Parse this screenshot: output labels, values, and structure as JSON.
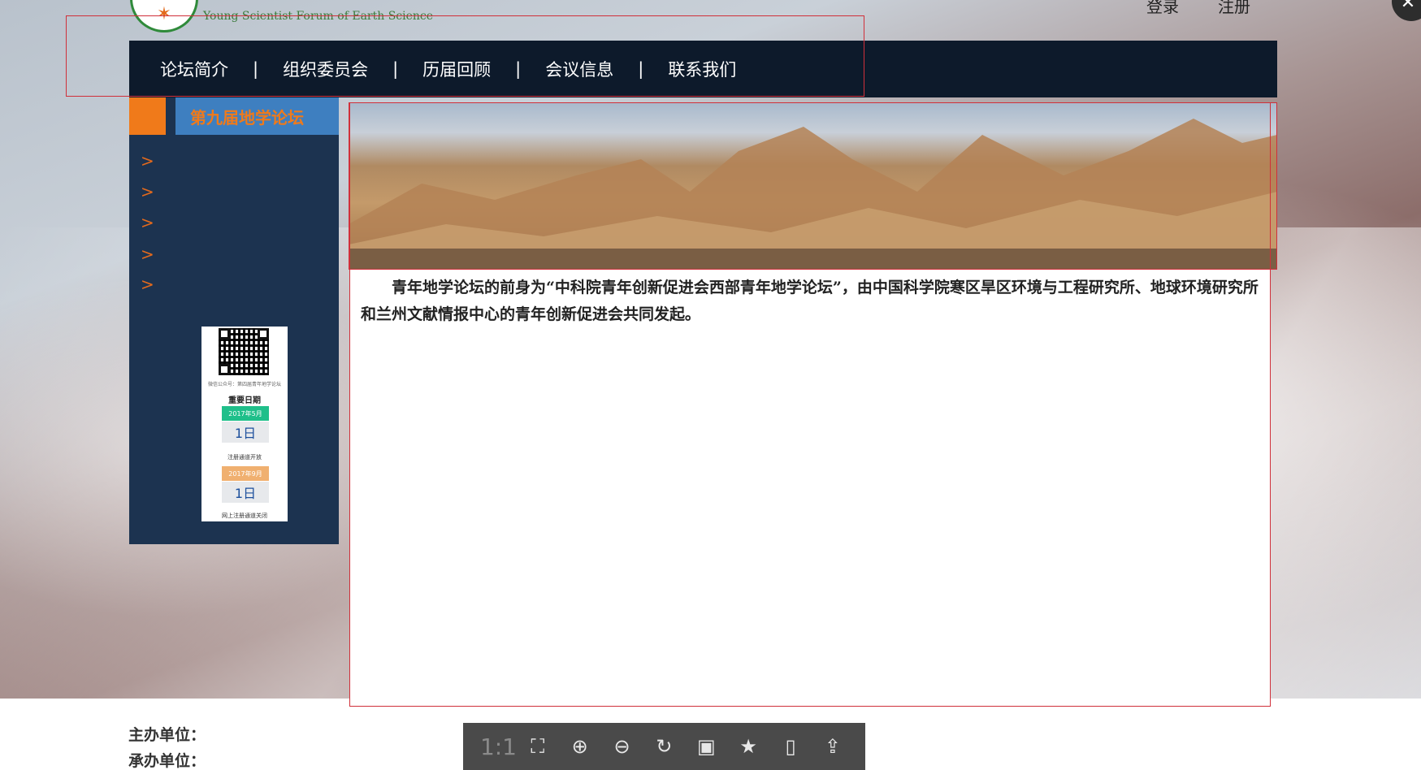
{
  "header": {
    "subtitle": "Young Scientist Forum of Earth Science",
    "login_label": "登录",
    "register_label": "注册",
    "close_icon": "close-icon"
  },
  "nav": {
    "items": [
      "论坛简介",
      "组织委员会",
      "历届回顾",
      "会议信息",
      "联系我们"
    ],
    "separator": "|"
  },
  "sidebar": {
    "title": "第九届地学论坛",
    "arrow_glyph": ">",
    "qr_caption": "微信公众号：第四届青年地学论坛",
    "dates_title": "重要日期",
    "dates": [
      {
        "month": "2017年5月",
        "day": "1日",
        "note": "注册通道开放",
        "color": "#1fbf8a"
      },
      {
        "month": "2017年9月",
        "day": "1日",
        "note": "网上注册通道关闭",
        "color": "#f0b070"
      }
    ]
  },
  "content": {
    "intro": "青年地学论坛的前身为“中科院青年创新促进会西部青年地学论坛”，由中国科学院寒区旱区环境与工程研究所、地球环境研究所和兰州文献情报中心的青年创新促进会共同发起。"
  },
  "footer": {
    "host_label": "主办单位：",
    "organizer_label": "承办单位："
  },
  "viewer_toolbar": {
    "actual_size_label": "1:1",
    "icons": [
      "fit-screen-icon",
      "zoom-in-icon",
      "zoom-out-icon",
      "rotate-icon",
      "save-icon",
      "bookmark-icon",
      "tablet-icon",
      "share-icon"
    ]
  }
}
